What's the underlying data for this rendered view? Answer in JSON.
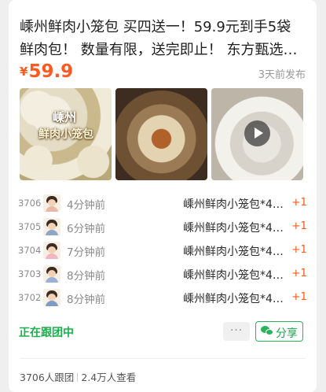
{
  "post": {
    "title": "嵊州鲜肉小笼包 买四送一！59.9元到手5袋鲜肉包！ 数量有限，送完即止！ 东方甄选推荐，嵊州鲜肉小笼包",
    "price_currency": "¥",
    "price_amount": "59.9",
    "posted": "3天前发布",
    "photo_label_top": "嵊州",
    "photo_label_sub": "鲜肉小笼包",
    "video_icon": "play-icon"
  },
  "followers": [
    {
      "num": "3706",
      "time": "4分钟前",
      "item": "嵊州鲜肉小笼包*4…",
      "qty": "+1"
    },
    {
      "num": "3705",
      "time": "6分钟前",
      "item": "嵊州鲜肉小笼包*4…",
      "qty": "+1"
    },
    {
      "num": "3704",
      "time": "7分钟前",
      "item": "嵊州鲜肉小笼包*4…",
      "qty": "+1"
    },
    {
      "num": "3703",
      "time": "8分钟前",
      "item": "嵊州鲜肉小笼包*4…",
      "qty": "+1"
    },
    {
      "num": "3702",
      "time": "8分钟前",
      "item": "嵊州鲜肉小笼包*4…",
      "qty": "+1"
    }
  ],
  "actions": {
    "status": "正在跟团中",
    "more": "···",
    "share": "分享"
  },
  "stats": {
    "joined": "3706人跟团",
    "views": "2.4万人查看"
  },
  "colors": {
    "accent_price": "#ff5a1f",
    "accent_green": "#19b14a"
  }
}
